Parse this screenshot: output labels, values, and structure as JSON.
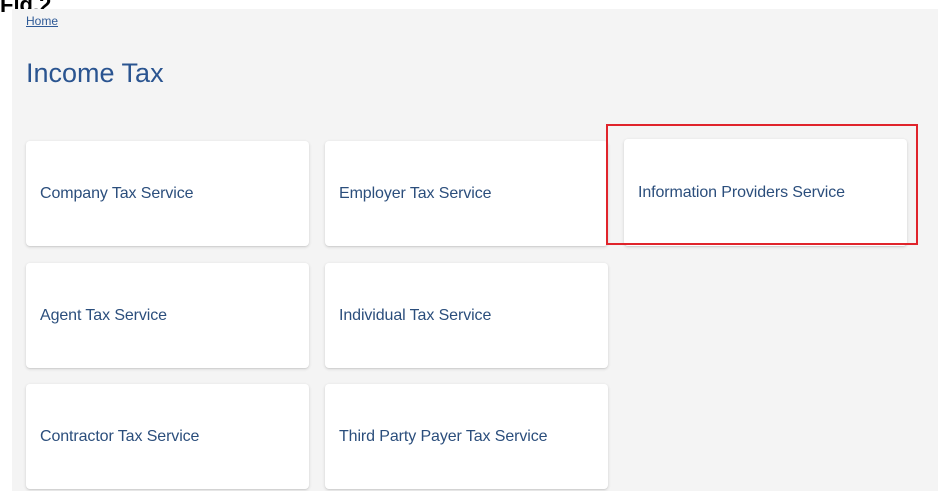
{
  "figure_label": "Fig.2",
  "breadcrumb": {
    "home": "Home"
  },
  "page_title": "Income Tax",
  "tiles": [
    {
      "label": "Company Tax Service"
    },
    {
      "label": "Employer Tax Service"
    },
    {
      "label": "Information Providers Service"
    },
    {
      "label": "Agent Tax Service"
    },
    {
      "label": "Individual Tax Service"
    },
    {
      "label": "Contractor Tax Service"
    },
    {
      "label": "Third Party Payer Tax Service"
    }
  ],
  "colors": {
    "link": "#2f5a97",
    "title": "#2a5490",
    "tile_text": "#2b4e7c",
    "highlight_border": "#e0242b",
    "page_background": "#f4f4f4"
  }
}
